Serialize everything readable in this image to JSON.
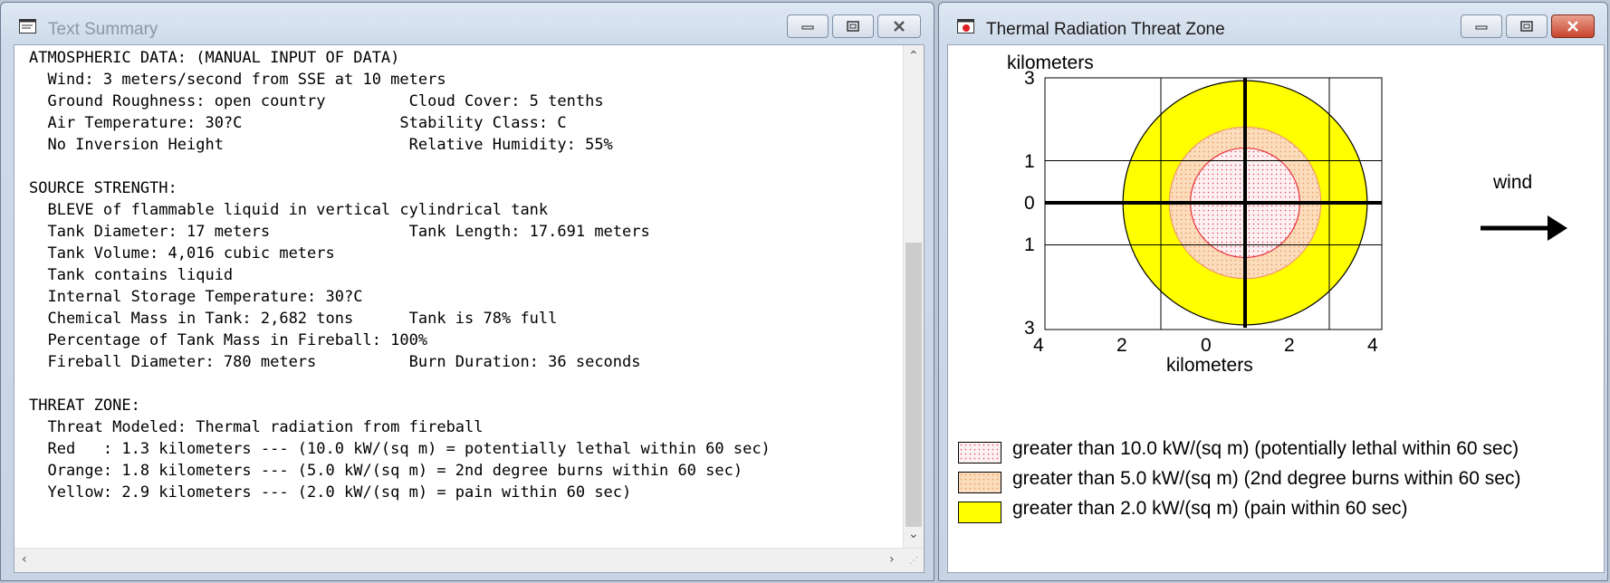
{
  "left_window": {
    "title": "Text Summary",
    "lines": [
      "ATMOSPHERIC DATA: (MANUAL INPUT OF DATA)",
      "  Wind: 3 meters/second from SSE at 10 meters",
      "  Ground Roughness: open country         Cloud Cover: 5 tenths",
      "  Air Temperature: 30?C                 Stability Class: C",
      "  No Inversion Height                    Relative Humidity: 55%",
      "",
      "SOURCE STRENGTH:",
      "  BLEVE of flammable liquid in vertical cylindrical tank",
      "  Tank Diameter: 17 meters               Tank Length: 17.691 meters",
      "  Tank Volume: 4,016 cubic meters",
      "  Tank contains liquid",
      "  Internal Storage Temperature: 30?C",
      "  Chemical Mass in Tank: 2,682 tons      Tank is 78% full",
      "  Percentage of Tank Mass in Fireball: 100%",
      "  Fireball Diameter: 780 meters          Burn Duration: 36 seconds",
      "",
      "THREAT ZONE:",
      "  Threat Modeled: Thermal radiation from fireball",
      "  Red   : 1.3 kilometers --- (10.0 kW/(sq m) = potentially lethal within 60 sec)",
      "  Orange: 1.8 kilometers --- (5.0 kW/(sq m) = 2nd degree burns within 60 sec)",
      "  Yellow: 2.9 kilometers --- (2.0 kW/(sq m) = pain within 60 sec)"
    ]
  },
  "right_window": {
    "title": "Thermal Radiation Threat Zone",
    "y_axis_title": "kilometers",
    "x_axis_title": "kilometers",
    "y_ticks": [
      "3",
      "1",
      "0",
      "1",
      "3"
    ],
    "x_ticks": [
      "4",
      "2",
      "0",
      "2",
      "4"
    ],
    "wind_label": "wind",
    "zones": [
      {
        "name": "red",
        "radius_km": 1.3,
        "fill": "#f8e8ec",
        "stroke": "#e8303a"
      },
      {
        "name": "orange",
        "radius_km": 1.8,
        "fill": "#fad8b4",
        "stroke": "#f09a6a"
      },
      {
        "name": "yellow",
        "radius_km": 2.9,
        "fill": "#ffff00",
        "stroke": "#000000"
      }
    ],
    "legend": [
      "greater than 10.0 kW/(sq m) (potentially lethal within 60 sec)",
      "greater than 5.0 kW/(sq m) (2nd degree burns within 60 sec)",
      "greater than 2.0 kW/(sq m) (pain within 60 sec)"
    ]
  }
}
